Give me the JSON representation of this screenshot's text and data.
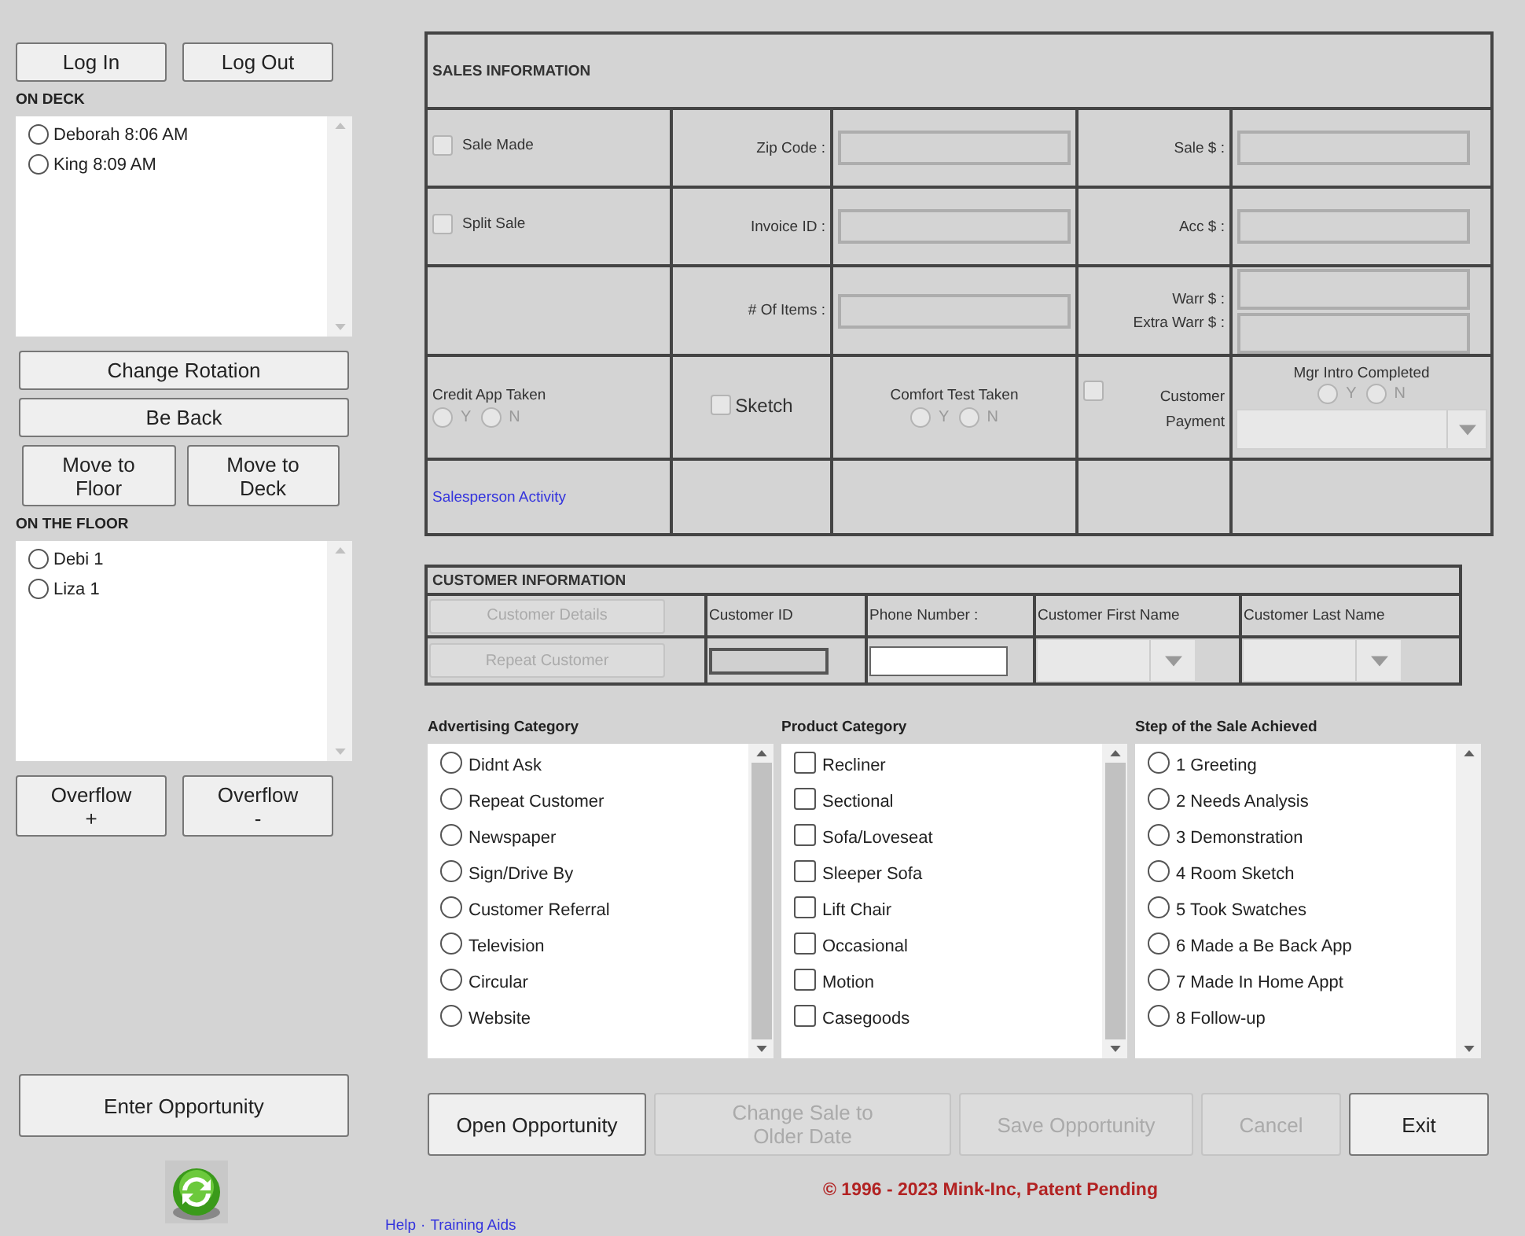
{
  "session_buttons": [
    {
      "label": "Log In"
    },
    {
      "label": "Log Out"
    }
  ],
  "on_deck": {
    "title": "ON DECK",
    "items": [
      {
        "label": "Deborah 8:06 AM",
        "selected": false
      },
      {
        "label": "King 8:09 AM",
        "selected": false
      }
    ]
  },
  "rotation_buttons": [
    {
      "label": "Change Rotation"
    },
    {
      "label": "Be Back"
    }
  ],
  "move_buttons": [
    {
      "label": "Move to\nFloor"
    },
    {
      "label": "Move to\nDeck"
    }
  ],
  "on_floor": {
    "title": "ON THE FLOOR",
    "items": [
      {
        "label": "Debi 1",
        "selected": false
      },
      {
        "label": "Liza 1",
        "selected": false
      }
    ]
  },
  "overflow_buttons": [
    {
      "label": "Overflow\n+"
    },
    {
      "label": "Overflow\n-"
    }
  ],
  "enter_opportunity": {
    "label": "Enter Opportunity"
  },
  "sales_information": {
    "title": "SALES INFORMATION",
    "sale_made": {
      "label": "Sale Made",
      "checked": false
    },
    "split_sale": {
      "label": "Split Sale",
      "checked": false
    },
    "zip_code": {
      "label": "Zip Code :"
    },
    "invoice_id": {
      "label": "Invoice ID :"
    },
    "items_count": {
      "label": "# Of Items :"
    },
    "sale_amount": {
      "label": "Sale $ :"
    },
    "acc_amount": {
      "label": "Acc $ :"
    },
    "warr_amount": {
      "label": "Warr $ :"
    },
    "extra_warr_amount": {
      "label": "Extra Warr $ :"
    },
    "credit_app": {
      "label": "Credit App Taken",
      "options": [
        {
          "label": "Y",
          "selected": false
        },
        {
          "label": "N",
          "selected": false
        }
      ]
    },
    "sketch": {
      "label": "Sketch",
      "checked": false
    },
    "comfort_test": {
      "label": "Comfort Test Taken",
      "options": [
        {
          "label": "Y",
          "selected": false
        },
        {
          "label": "N",
          "selected": false
        }
      ]
    },
    "customer_payment": {
      "label": "Customer Payment",
      "checked": false
    },
    "mgr_intro": {
      "label": "Mgr Intro Completed",
      "options": [
        {
          "label": "Y",
          "selected": false
        },
        {
          "label": "N",
          "selected": false
        }
      ]
    },
    "salesperson_activity": {
      "label": "Salesperson Activity"
    }
  },
  "customer_information": {
    "title": "CUSTOMER INFORMATION",
    "buttons": [
      {
        "label": "Customer Details",
        "disabled": true
      },
      {
        "label": "Repeat Customer",
        "disabled": true
      }
    ],
    "columns": [
      "Customer ID",
      "Phone Number :",
      "Customer First Name",
      "Customer Last Name"
    ]
  },
  "categories": [
    {
      "title": "Advertising Category",
      "kind": "radio",
      "scrollbar_thumb": true,
      "items": [
        {
          "label": "Didnt Ask",
          "selected": false
        },
        {
          "label": "Repeat Customer",
          "selected": false
        },
        {
          "label": "Newspaper",
          "selected": false
        },
        {
          "label": "Sign/Drive By",
          "selected": false
        },
        {
          "label": "Customer Referral",
          "selected": false
        },
        {
          "label": "Television",
          "selected": false
        },
        {
          "label": "Circular",
          "selected": false
        },
        {
          "label": "Website",
          "selected": false
        }
      ]
    },
    {
      "title": "Product Category",
      "kind": "checkbox",
      "scrollbar_thumb": true,
      "items": [
        {
          "label": "Recliner",
          "checked": false
        },
        {
          "label": "Sectional",
          "checked": false
        },
        {
          "label": "Sofa/Loveseat",
          "checked": false
        },
        {
          "label": "Sleeper Sofa",
          "checked": false
        },
        {
          "label": "Lift Chair",
          "checked": false
        },
        {
          "label": "Occasional",
          "checked": false
        },
        {
          "label": "Motion",
          "checked": false
        },
        {
          "label": "Casegoods",
          "checked": false
        }
      ]
    },
    {
      "title": "Step of the Sale Achieved",
      "kind": "radio",
      "scrollbar_thumb": false,
      "items": [
        {
          "label": "1 Greeting",
          "selected": false
        },
        {
          "label": "2 Needs Analysis",
          "selected": false
        },
        {
          "label": "3 Demonstration",
          "selected": false
        },
        {
          "label": "4 Room Sketch",
          "selected": false
        },
        {
          "label": "5 Took Swatches",
          "selected": false
        },
        {
          "label": "6 Made a Be Back App",
          "selected": false
        },
        {
          "label": "7 Made In Home Appt",
          "selected": false
        },
        {
          "label": "8 Follow-up",
          "selected": false
        }
      ]
    }
  ],
  "actions": [
    {
      "label": "Open Opportunity",
      "disabled": false
    },
    {
      "label": "Change  Sale to\nOlder Date",
      "disabled": true
    },
    {
      "label": "Save Opportunity",
      "disabled": true
    },
    {
      "label": "Cancel",
      "disabled": true
    },
    {
      "label": "Exit",
      "disabled": false
    }
  ],
  "copyright": "© 1996 - 2023 Mink-Inc, Patent Pending",
  "footer_links": [
    {
      "label": "Help"
    },
    {
      "label": "Training Aids"
    }
  ],
  "footer_separator": "·"
}
